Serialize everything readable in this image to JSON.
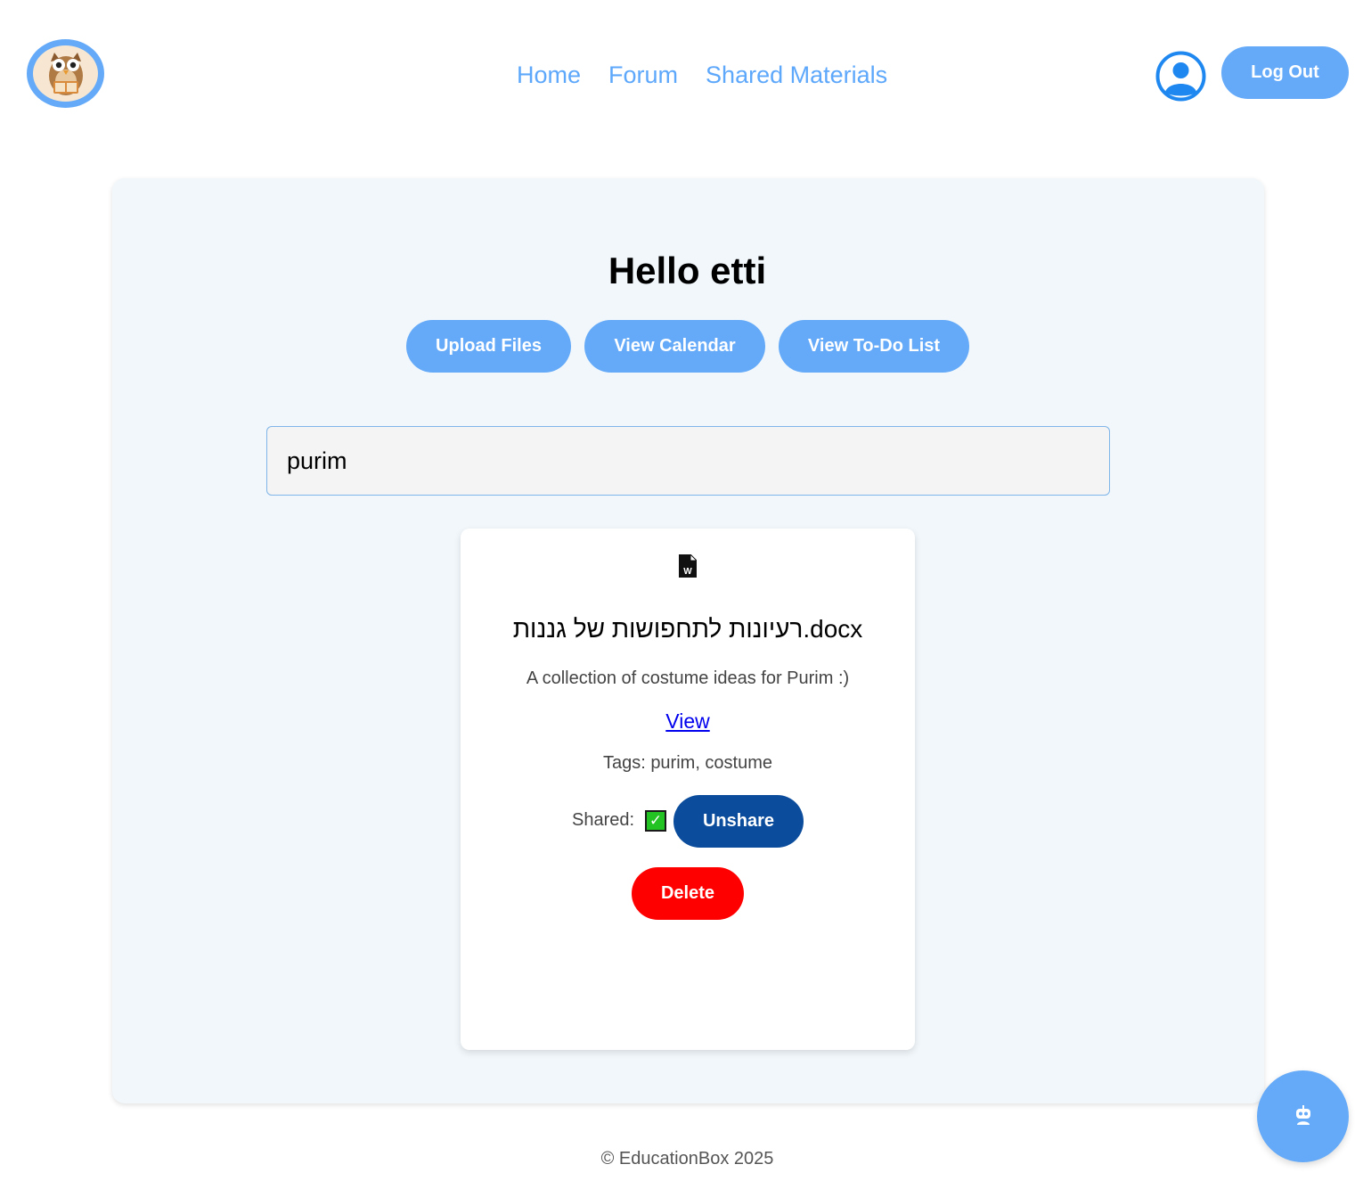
{
  "header": {
    "logo_icon": "owl-reading-book-icon",
    "nav": [
      {
        "label": "Home"
      },
      {
        "label": "Forum"
      },
      {
        "label": "Shared Materials"
      }
    ],
    "profile_icon": "user-circle-icon",
    "logout_label": "Log Out"
  },
  "main": {
    "greeting": "Hello etti",
    "actions": {
      "upload": "Upload Files",
      "calendar": "View Calendar",
      "todo": "View To-Do List"
    },
    "search": {
      "value": "purim"
    },
    "file_card": {
      "icon": "word-document-icon",
      "filename": "רעיונות לתחפושות של גננות.docx",
      "description": "A collection of costume ideas for Purim :)",
      "view_link": "View",
      "tags": "Tags: purim, costume",
      "shared_label": "Shared:",
      "shared_mark": "✓",
      "unshare_label": "Unshare",
      "delete_label": "Delete"
    }
  },
  "footer": {
    "text": "© EducationBox 2025"
  },
  "chatbot_icon": "robot-icon",
  "colors": {
    "accent": "#64aaf8",
    "nav_link": "#5ea8fb",
    "unshare": "#0b4d9c",
    "delete": "#ff0000",
    "panel_bg": "#f1f7fb",
    "shared_check": "#23c323"
  }
}
